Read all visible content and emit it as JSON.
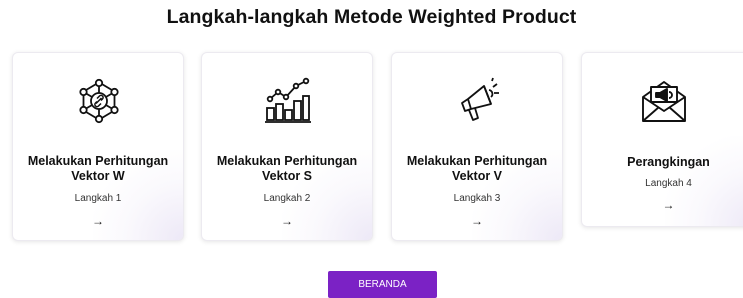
{
  "page": {
    "title": "Langkah-langkah Metode Weighted Product"
  },
  "cards": [
    {
      "icon": "network-hub-icon",
      "title": "Melakukan Perhitungan Vektor W",
      "step": "Langkah 1",
      "arrow": "→"
    },
    {
      "icon": "bar-chart-trend-icon",
      "title": "Melakukan Perhitungan Vektor S",
      "step": "Langkah 2",
      "arrow": "→"
    },
    {
      "icon": "megaphone-icon",
      "title": "Melakukan Perhitungan Vektor V",
      "step": "Langkah 3",
      "arrow": "→"
    },
    {
      "icon": "envelope-megaphone-icon",
      "title": "Perangkingan",
      "step": "Langkah 4",
      "arrow": "→"
    }
  ],
  "footer": {
    "home_label": "BERANDA"
  },
  "colors": {
    "accent": "#7b22c5",
    "text": "#111111",
    "card_border": "#eceaf0"
  }
}
